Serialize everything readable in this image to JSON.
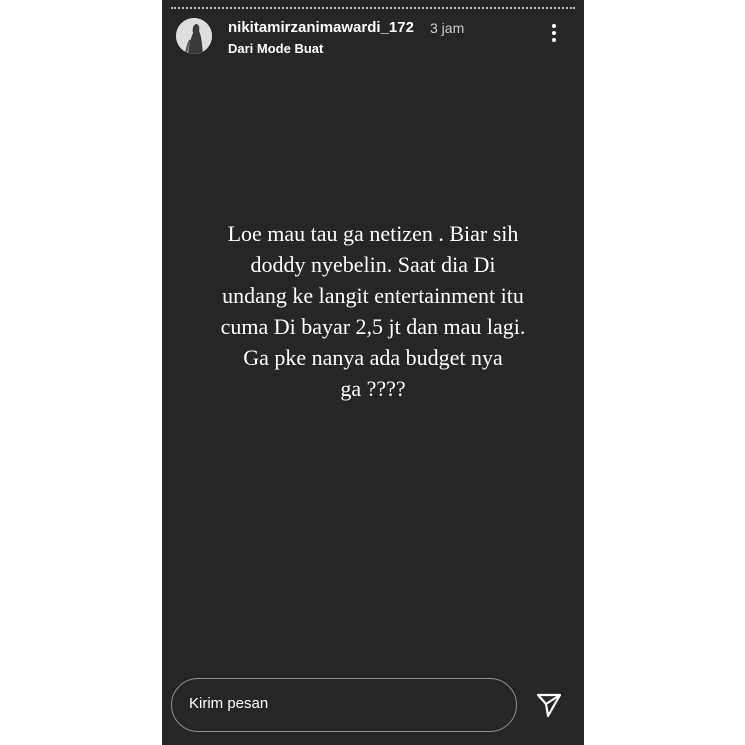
{
  "header": {
    "username": "nikitamirzanimawardi_172",
    "time": "3 jam",
    "subtitle": "Dari Mode Buat"
  },
  "story": {
    "text": "Loe mau tau ga netizen . Biar sih\ndoddy nyebelin. Saat dia Di\nundang ke langit entertainment itu\ncuma Di bayar 2,5 jt dan mau lagi.\nGa pke nanya ada budget nya\nga ????"
  },
  "reply": {
    "placeholder": "Kirim pesan"
  },
  "icons": {
    "more": "more-options-icon",
    "send": "send-icon"
  },
  "colors": {
    "background": "#262626",
    "text": "#ffffff",
    "page": "#ffffff"
  }
}
